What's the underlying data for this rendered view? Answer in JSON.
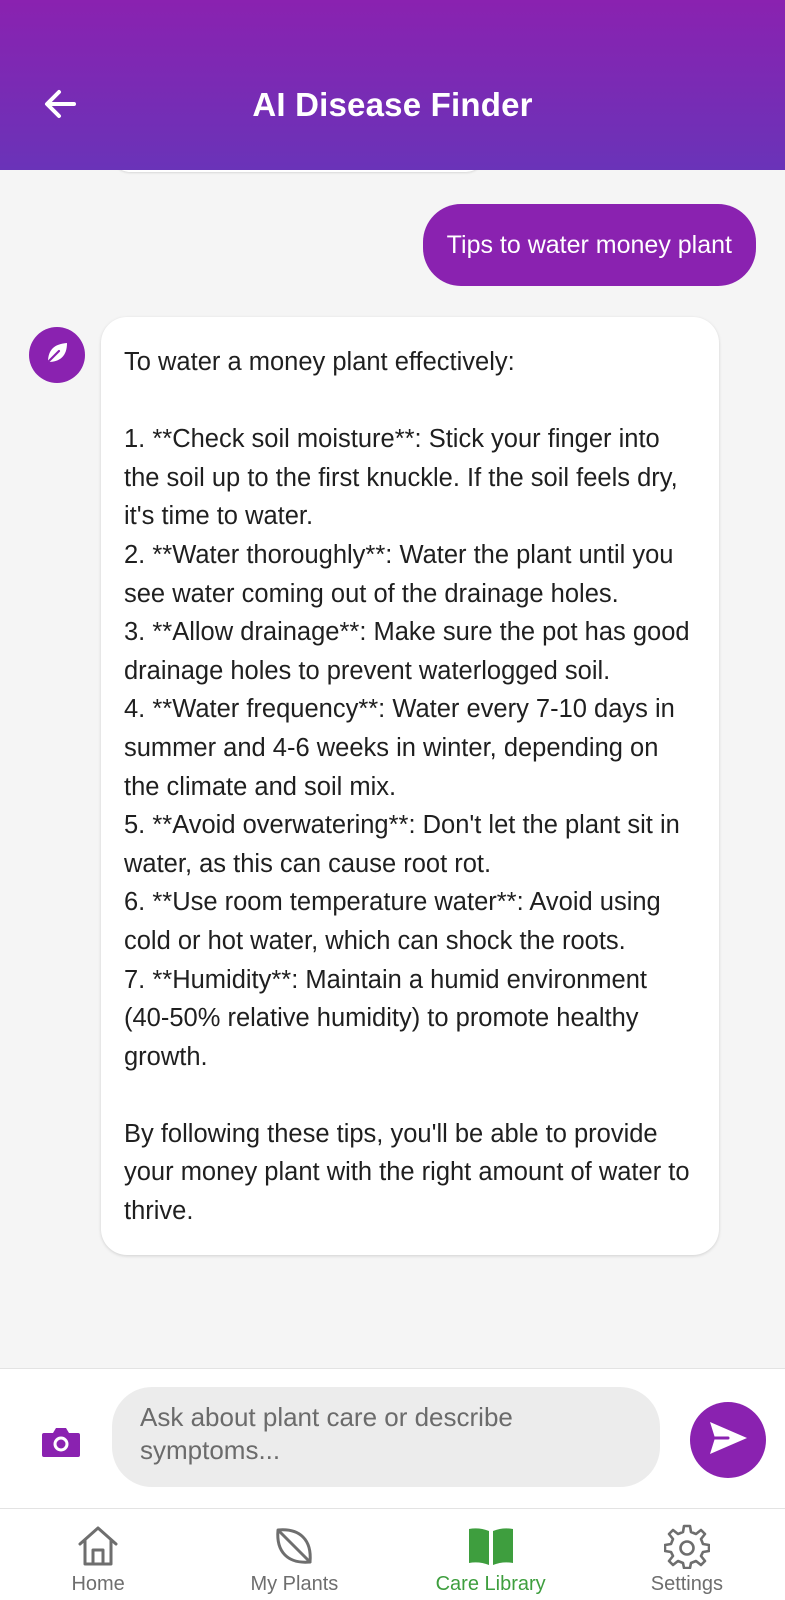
{
  "header": {
    "title": "AI Disease Finder",
    "back_icon": "arrow-left-icon"
  },
  "chat": {
    "user_message": "Tips to water money plant",
    "bot_avatar_icon": "leaf-icon",
    "bot_message": "To water a money plant effectively:\n\n1. **Check soil moisture**: Stick your finger into the soil up to the first knuckle. If the soil feels dry, it's time to water.\n2. **Water thoroughly**: Water the plant until you see water coming out of the drainage holes.\n3. **Allow drainage**: Make sure the pot has good drainage holes to prevent waterlogged soil.\n4. **Water frequency**: Water every 7-10 days in summer and 4-6 weeks in winter, depending on the climate and soil mix.\n5. **Avoid overwatering**: Don't let the plant sit in water, as this can cause root rot.\n6. **Use room temperature water**: Avoid using cold or hot water, which can shock the roots.\n7. **Humidity**: Maintain a humid environment (40-50% relative humidity) to promote healthy growth.\n\nBy following these tips, you'll be able to provide your money plant with the right amount of water to thrive."
  },
  "input": {
    "placeholder": "Ask about plant care or describe symptoms...",
    "camera_icon": "camera-icon",
    "send_icon": "send-icon"
  },
  "nav": {
    "items": [
      {
        "label": "Home",
        "icon": "home-icon",
        "active": false
      },
      {
        "label": "My Plants",
        "icon": "leaf-icon",
        "active": false
      },
      {
        "label": "Care Library",
        "icon": "book-icon",
        "active": true
      },
      {
        "label": "Settings",
        "icon": "gear-icon",
        "active": false
      }
    ]
  },
  "colors": {
    "primary": "#8a22b0",
    "header_gradient_end": "#6a33b8",
    "active_nav": "#3e9e3e",
    "background": "#f5f5f5"
  }
}
